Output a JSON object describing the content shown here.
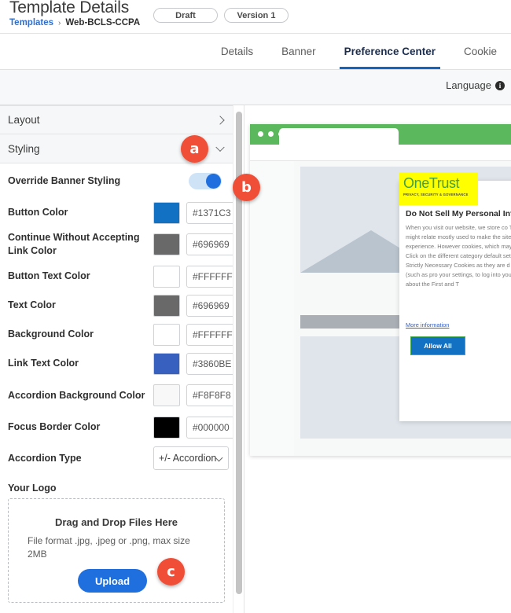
{
  "header": {
    "title": "Template Details",
    "status_pill": "Draft",
    "version_pill": "Version 1",
    "breadcrumb_root": "Templates",
    "breadcrumb_sep": "›",
    "breadcrumb_current": "Web-BCLS-CCPA"
  },
  "tabs": [
    {
      "label": "Details",
      "active": false
    },
    {
      "label": "Banner",
      "active": false
    },
    {
      "label": "Preference Center",
      "active": true
    },
    {
      "label": "Cookie",
      "active": false
    }
  ],
  "language_bar": {
    "label": "Language",
    "info_glyph": "i"
  },
  "accordions": [
    {
      "label": "Layout",
      "expanded": false,
      "icon": "chevron-right-icon"
    },
    {
      "label": "Styling",
      "expanded": true,
      "icon": "chevron-down-icon"
    }
  ],
  "styling": {
    "override_toggle": {
      "label": "Override Banner Styling",
      "value": "on"
    },
    "color_rows": [
      {
        "label": "Button Color",
        "hex": "#1371C3",
        "swatch": "#1371C3"
      },
      {
        "label": "Continue Without Accepting Link Color",
        "hex": "#696969",
        "swatch": "#696969"
      },
      {
        "label": "Button Text Color",
        "hex": "#FFFFFF",
        "swatch": "#FFFFFF"
      },
      {
        "label": "Text Color",
        "hex": "#696969",
        "swatch": "#696969"
      },
      {
        "label": "Background Color",
        "hex": "#FFFFFF",
        "swatch": "#FFFFFF"
      },
      {
        "label": "Link Text Color",
        "hex": "#3860BE",
        "swatch": "#3860BE"
      },
      {
        "label": "Accordion Background Color",
        "hex": "#F8F8F8",
        "swatch": "#F8F8F8"
      },
      {
        "label": "Focus Border Color",
        "hex": "#000000",
        "swatch": "#000000"
      }
    ],
    "accordion_type": {
      "label": "Accordion Type",
      "value": "+/- Accordion"
    },
    "logo": {
      "section_label": "Your Logo",
      "drop_title": "Drag and Drop Files Here",
      "drop_hint": "File format .jpg, .jpeg or .png, max size 2MB",
      "upload_label": "Upload"
    }
  },
  "preview": {
    "browser_dots": 3,
    "logo": {
      "name": "OneTrust",
      "tagline": "PRIVACY, SECURITY & GOVERNANCE",
      "highlight_color": "#FFFF00",
      "text_color": "#43A047"
    },
    "preference_center": {
      "title": "Do Not Sell My Personal Infor",
      "body": "When you visit our website, we store co The information collected might relate mostly used to make the site work as y personalized web experience. However cookies, which may impact your experi to offer. Click on the different category default settings according to your prefe Strictly Necessary Cookies as they are d functioning of our website (such as pro your settings, to log into your account, more information about the First and T",
      "more_link": "More information",
      "allow_all": "Allow All"
    }
  },
  "markers": [
    {
      "id": "a",
      "label": "a"
    },
    {
      "id": "b",
      "label": "b"
    },
    {
      "id": "c",
      "label": "c"
    }
  ],
  "colors": {
    "accent_blue": "#1371C3",
    "toggle_on": "#1F6FDE",
    "marker_red": "#F04E37",
    "browser_green": "#5CB85C",
    "tab_underline": "#1565C0"
  }
}
